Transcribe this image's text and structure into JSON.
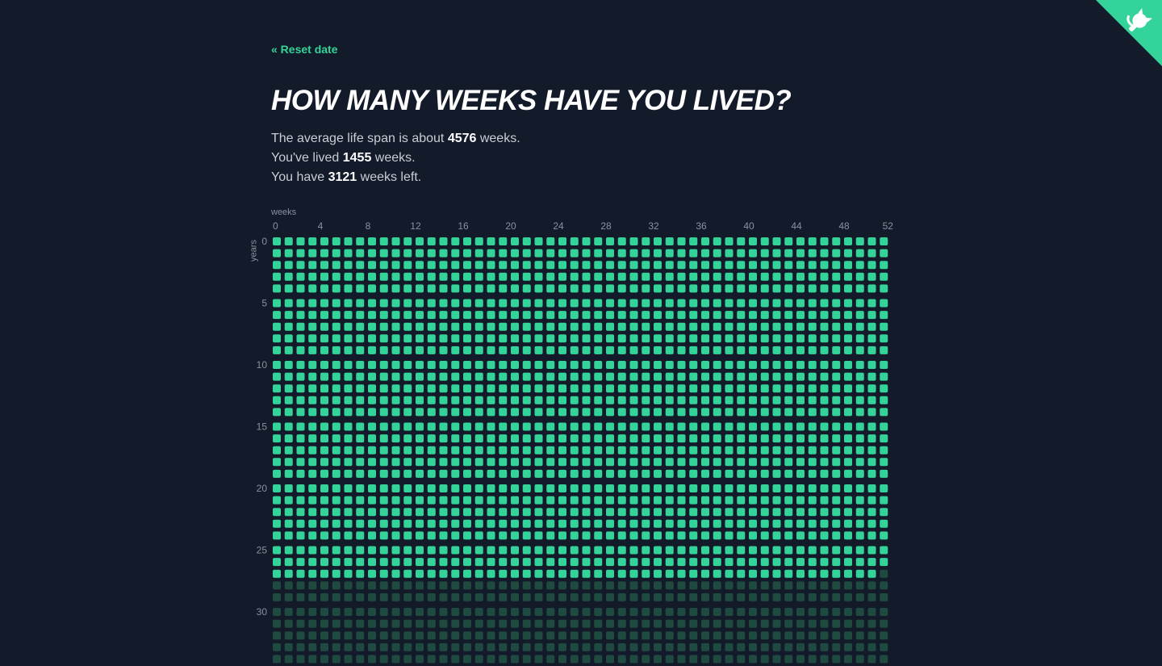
{
  "nav": {
    "reset_label": "« Reset date"
  },
  "header": {
    "title": "HOW MANY WEEKS HAVE YOU LIVED?"
  },
  "stats": {
    "avg_prefix": "The average life span is about ",
    "avg_weeks": "4576",
    "avg_suffix": " weeks.",
    "lived_prefix": "You've lived ",
    "lived_weeks": "1455",
    "lived_suffix": " weeks.",
    "left_prefix": "You have ",
    "left_weeks": "3121",
    "left_suffix": " weeks left."
  },
  "corner": {
    "icon": "github-octocat-icon",
    "color": "#34d399"
  },
  "chart_data": {
    "type": "heatmap",
    "xlabel": "weeks",
    "ylabel": "years",
    "x_ticks": [
      0,
      4,
      8,
      12,
      16,
      20,
      24,
      28,
      32,
      36,
      40,
      44,
      48,
      52
    ],
    "y_ticks": [
      0,
      5,
      10,
      15,
      20,
      25,
      30
    ],
    "weeks_per_year": 52,
    "visible_years": 36,
    "weeks_lived": 1455,
    "average_life_weeks": 4576,
    "colors": {
      "lived": "#34d399",
      "remaining": "#1e4a40",
      "background": "#131a29"
    }
  }
}
